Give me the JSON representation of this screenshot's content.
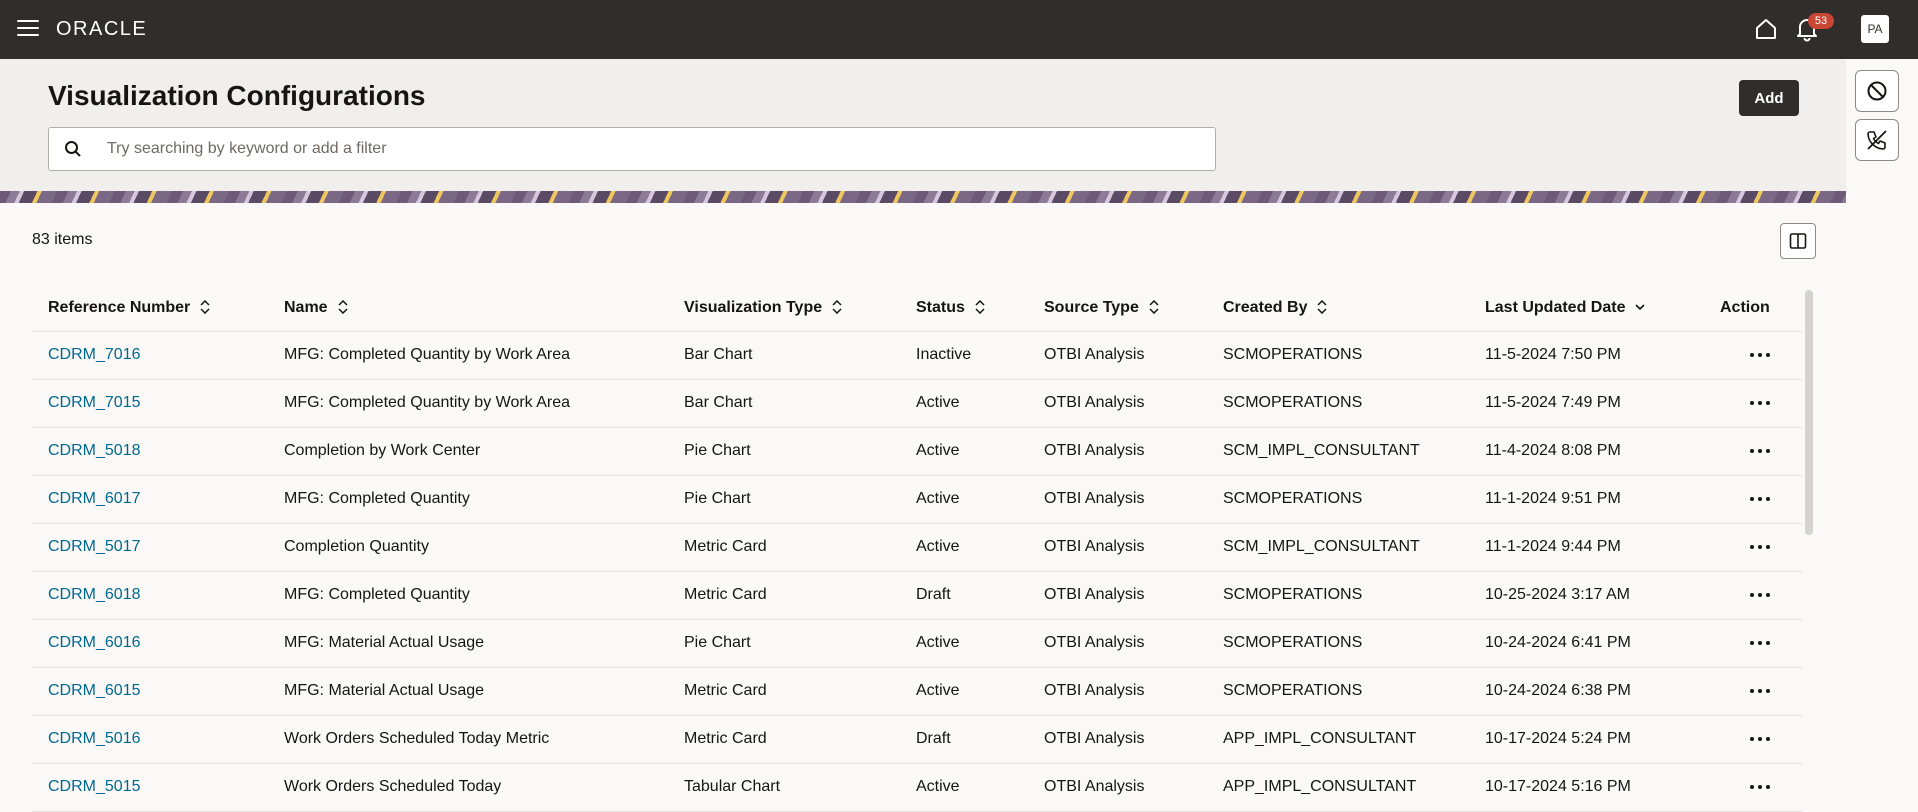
{
  "header": {
    "brand": "ORACLE",
    "notification_count": "53",
    "avatar_initials": "PA"
  },
  "page": {
    "title": "Visualization Configurations",
    "add_label": "Add",
    "search_placeholder": "Try searching by keyword or add a filter",
    "item_count": "83 items"
  },
  "table": {
    "columns": [
      {
        "label": "Reference Number",
        "sortable": true,
        "sort": "none"
      },
      {
        "label": "Name",
        "sortable": true,
        "sort": "none"
      },
      {
        "label": "Visualization Type",
        "sortable": true,
        "sort": "none"
      },
      {
        "label": "Status",
        "sortable": true,
        "sort": "none"
      },
      {
        "label": "Source Type",
        "sortable": true,
        "sort": "none"
      },
      {
        "label": "Created By",
        "sortable": true,
        "sort": "none"
      },
      {
        "label": "Last Updated Date",
        "sortable": true,
        "sort": "descending"
      },
      {
        "label": "Action",
        "sortable": false,
        "sort": "none"
      }
    ],
    "rows": [
      {
        "ref": "CDRM_7016",
        "name": "MFG: Completed Quantity by Work Area",
        "type": "Bar Chart",
        "status": "Inactive",
        "source": "OTBI Analysis",
        "created_by": "SCMOPERATIONS",
        "updated": "11-5-2024 7:50 PM"
      },
      {
        "ref": "CDRM_7015",
        "name": "MFG: Completed Quantity by Work Area",
        "type": "Bar Chart",
        "status": "Active",
        "source": "OTBI Analysis",
        "created_by": "SCMOPERATIONS",
        "updated": "11-5-2024 7:49 PM"
      },
      {
        "ref": "CDRM_5018",
        "name": "Completion by Work Center",
        "type": "Pie Chart",
        "status": "Active",
        "source": "OTBI Analysis",
        "created_by": "SCM_IMPL_CONSULTANT",
        "updated": "11-4-2024 8:08 PM"
      },
      {
        "ref": "CDRM_6017",
        "name": "MFG: Completed Quantity",
        "type": "Pie Chart",
        "status": "Active",
        "source": "OTBI Analysis",
        "created_by": "SCMOPERATIONS",
        "updated": "11-1-2024 9:51 PM"
      },
      {
        "ref": "CDRM_5017",
        "name": "Completion Quantity",
        "type": "Metric Card",
        "status": "Active",
        "source": "OTBI Analysis",
        "created_by": "SCM_IMPL_CONSULTANT",
        "updated": "11-1-2024 9:44 PM"
      },
      {
        "ref": "CDRM_6018",
        "name": "MFG: Completed Quantity",
        "type": "Metric Card",
        "status": "Draft",
        "source": "OTBI Analysis",
        "created_by": "SCMOPERATIONS",
        "updated": "10-25-2024 3:17 AM"
      },
      {
        "ref": "CDRM_6016",
        "name": "MFG: Material Actual Usage",
        "type": "Pie Chart",
        "status": "Active",
        "source": "OTBI Analysis",
        "created_by": "SCMOPERATIONS",
        "updated": "10-24-2024 6:41 PM"
      },
      {
        "ref": "CDRM_6015",
        "name": "MFG: Material Actual Usage",
        "type": "Metric Card",
        "status": "Active",
        "source": "OTBI Analysis",
        "created_by": "SCMOPERATIONS",
        "updated": "10-24-2024 6:38 PM"
      },
      {
        "ref": "CDRM_5016",
        "name": "Work Orders Scheduled Today Metric",
        "type": "Metric Card",
        "status": "Draft",
        "source": "OTBI Analysis",
        "created_by": "APP_IMPL_CONSULTANT",
        "updated": "10-17-2024 5:24 PM"
      },
      {
        "ref": "CDRM_5015",
        "name": "Work Orders Scheduled Today",
        "type": "Tabular Chart",
        "status": "Active",
        "source": "OTBI Analysis",
        "created_by": "APP_IMPL_CONSULTANT",
        "updated": "10-17-2024 5:16 PM"
      }
    ]
  },
  "icons": {
    "menu": "hamburger-menu-icon",
    "home": "home-icon",
    "notifications": "bell-icon",
    "rail_1": "block-icon",
    "rail_2": "phone-off-icon",
    "panel": "split-panel-icon",
    "row_action": "more-horizontal-icon"
  },
  "colors": {
    "topbar": "#312d2a",
    "link": "#00688c",
    "badge": "#c74634"
  }
}
